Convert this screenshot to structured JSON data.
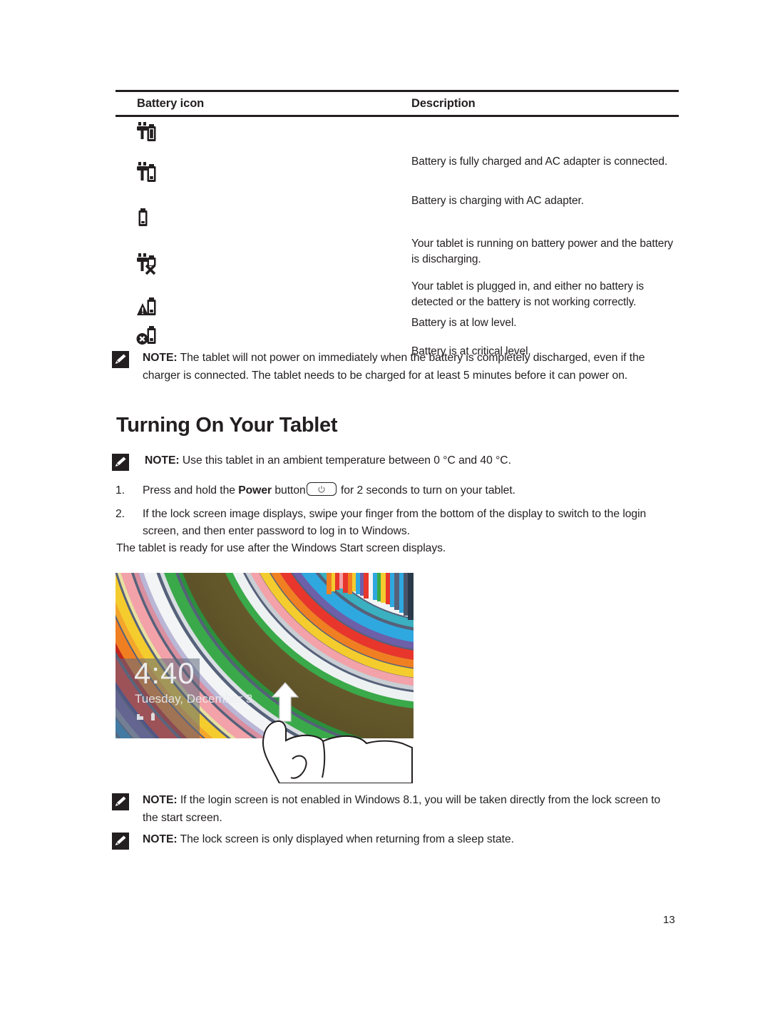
{
  "document": {
    "page_number": "13"
  },
  "battery_table": {
    "headers": [
      "Battery icon",
      "Description"
    ],
    "rows": [
      {
        "icon_name": "battery-full-plug-icon",
        "description": "Battery is fully charged and AC adapter is connected."
      },
      {
        "icon_name": "battery-charging-plug-icon",
        "description": "Battery is charging with AC adapter."
      },
      {
        "icon_name": "battery-discharging-icon",
        "description": "Your tablet is running on battery power and the battery is discharging."
      },
      {
        "icon_name": "plug-no-battery-error-icon",
        "description": "Your tablet is plugged in, and either no battery is detected or the battery is not working correctly."
      },
      {
        "icon_name": "battery-low-warning-icon",
        "description": "Battery is at low level."
      },
      {
        "icon_name": "battery-critical-icon",
        "description": "Battery is at critical level."
      }
    ]
  },
  "notes": {
    "battery_discharged": {
      "label": "NOTE:",
      "text": " The tablet will not power on immediately when the battery is completely discharged, even if the charger is connected. The tablet needs to be charged for at least 5 minutes before it can power on."
    },
    "ambient_temperature": {
      "label": "NOTE:",
      "text": " Use this tablet in an ambient temperature between 0 °C and 40 °C."
    },
    "login_screen_disabled": {
      "label": "NOTE:",
      "text": " If the login screen is not enabled in Windows 8.1, you will be taken directly from the lock screen to the start screen."
    },
    "lock_screen_sleep": {
      "label": "NOTE:",
      "text": " The lock screen is only displayed when returning from a sleep state."
    }
  },
  "section": {
    "heading": "Turning On Your Tablet",
    "steps": [
      {
        "number": "1.",
        "text_before": "Press and hold the ",
        "bold": "Power",
        "text_mid": " button",
        "text_after": " for 2 seconds to turn on your tablet.",
        "inline_icon": "power-button-icon"
      },
      {
        "number": "2.",
        "text_before": "If the lock screen image displays, swipe your finger from the bottom of the display to switch to the login screen, and then enter password to log in to Windows.",
        "bold": "",
        "text_mid": "",
        "text_after": ""
      }
    ],
    "ready_text": "The tablet is ready for use after the Windows Start screen displays."
  },
  "lock_screen": {
    "time": "4:40",
    "date": "Tuesday, December 3",
    "status_icons": [
      "network-icon",
      "battery-icon"
    ],
    "gesture": "swipe-up-hand-icon",
    "colors": {
      "blue": "#2fa8e0",
      "purple": "#6d5fa8",
      "red": "#e8362c",
      "orange": "#f07f22",
      "yellow": "#f4cc2e",
      "pink": "#f2a2a8",
      "white": "#f2f4f5",
      "green": "#3aa94a",
      "olive": "#7d6f33",
      "teal": "#3ab0c0"
    }
  }
}
